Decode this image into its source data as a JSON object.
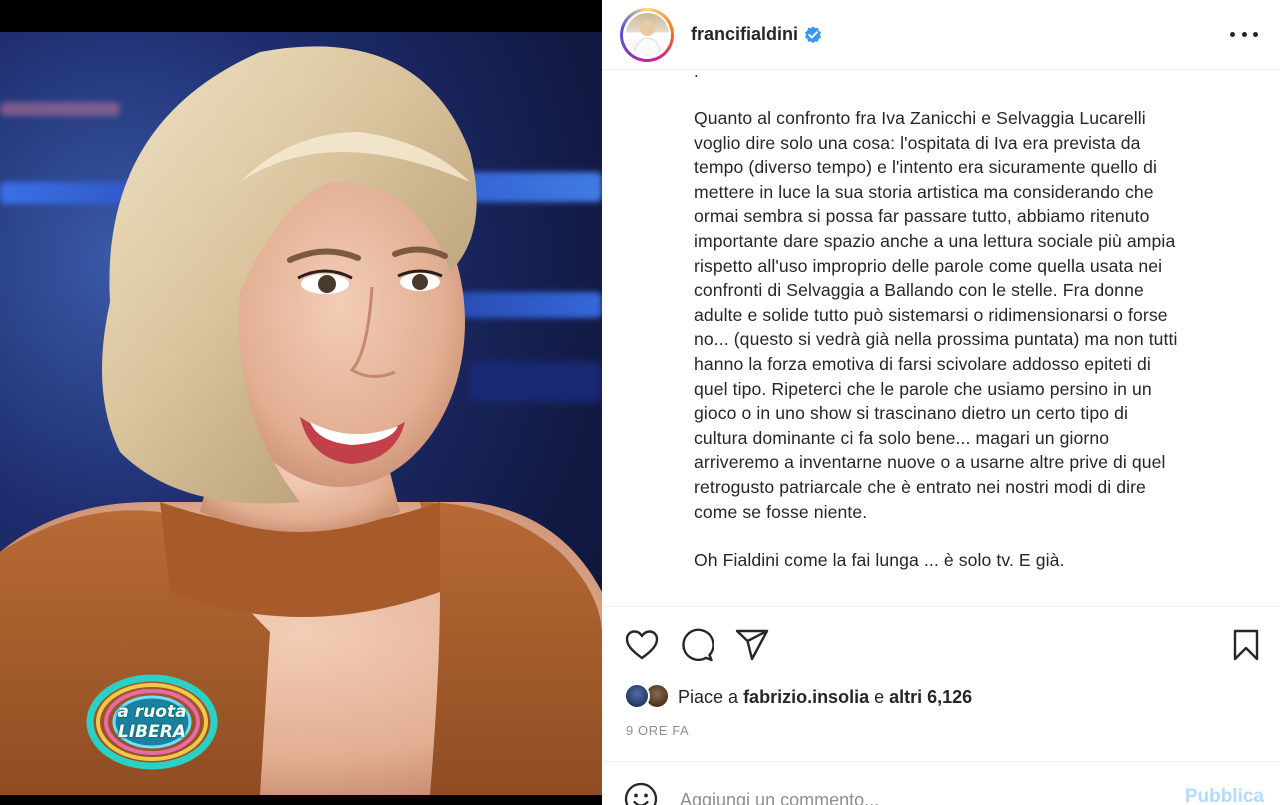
{
  "post": {
    "username": "francifialdini",
    "verified": true,
    "more_icon": "more-horizontal-icon",
    "caption_cut": ".",
    "caption_paragraph_1": [
      "Quanto al confronto fra Iva Zanicchi e Selvaggia Lucarelli",
      "voglio dire solo una cosa: l'ospitata di Iva era prevista da",
      "tempo (diverso tempo) e l'intento era sicuramente quello di",
      "mettere in luce la sua storia artistica ma considerando che",
      "ormai sembra si possa far passare tutto, abbiamo ritenuto",
      "importante dare spazio anche a una lettura sociale più ampia",
      "rispetto all'uso improprio delle parole come quella usata nei",
      "confronti di Selvaggia a Ballando con le stelle. Fra donne",
      "adulte e solide tutto può sistemarsi o ridimensionarsi o forse",
      "no... (questo si vedrà già nella prossima puntata) ma non tutti",
      "hanno la forza emotiva di farsi scivolare addosso epiteti di",
      "quel tipo. Ripeterci che le parole che usiamo persino in un",
      "gioco o in uno show si trascinano dietro un certo tipo di",
      "cultura dominante ci fa solo bene... magari un giorno",
      "arriveremo a inventarne nuove o a usarne altre prive di quel",
      "retrogusto patriarcale che è entrato nei nostri modi di dire",
      "come se fosse niente."
    ],
    "caption_paragraph_2": "Oh Fialdini come la fai lunga ... è solo tv. E già."
  },
  "photo": {
    "logo_line_1": "a ruota",
    "logo_line_2": "LIBERA"
  },
  "actions": {
    "like_icon": "heart-icon",
    "comment_icon": "comment-icon",
    "share_icon": "share-icon",
    "save_icon": "bookmark-icon"
  },
  "likes": {
    "prefix": "Piace a",
    "liker": "fabrizio.insolia",
    "conjunction": "e",
    "others": "altri 6,126"
  },
  "timestamp": "9 ORE FA",
  "comment": {
    "placeholder": "Aggiungi un commento...",
    "emoji_icon": "emoji-icon",
    "publish_label": "Pubblica"
  },
  "colors": {
    "verified_blue": "#3897f0",
    "publish_disabled": "#b3dbff",
    "text_primary": "#262626",
    "text_secondary": "#8e8e8e"
  }
}
